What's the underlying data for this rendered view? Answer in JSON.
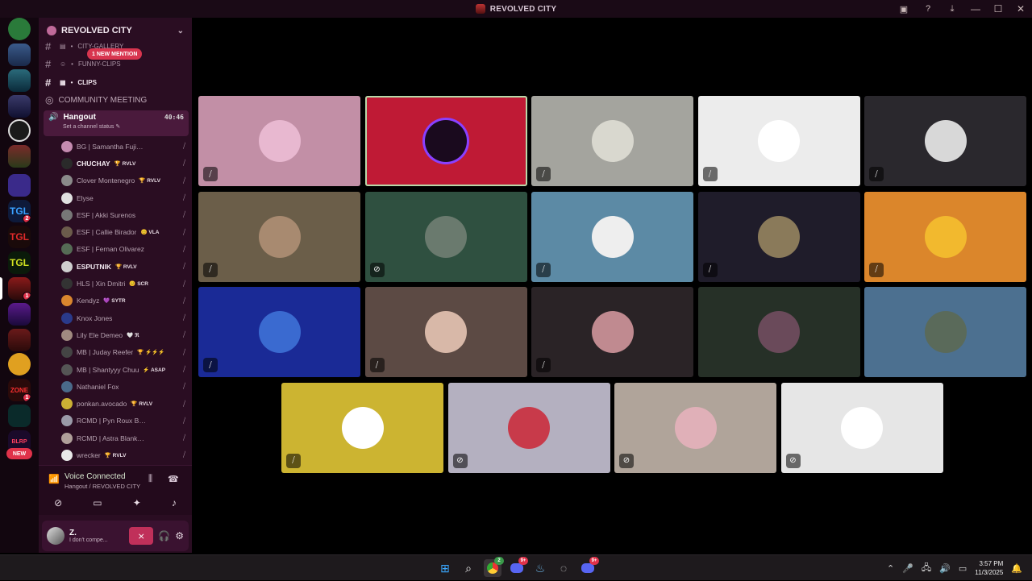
{
  "window": {
    "title": "REVOLVED CITY"
  },
  "titlebar_icons": [
    "inbox-icon",
    "help-icon",
    "download-icon"
  ],
  "server": {
    "name": "REVOLVED CITY",
    "new_badge": "NEW"
  },
  "server_badges": [
    "2",
    "1",
    "1",
    "1"
  ],
  "channels": [
    {
      "name": "CITY-GALLERY",
      "prefix": "•"
    },
    {
      "name": "FUNNY-CLIPS",
      "prefix": "•"
    },
    {
      "name": "CLIPS",
      "prefix": "•"
    }
  ],
  "mention_pill": "1 NEW MENTION",
  "voice_channels": {
    "community": "COMMUNITY MEETING",
    "hangout": {
      "name": "Hangout",
      "time": "40:46",
      "status": "Set a channel status"
    }
  },
  "members": [
    {
      "name": "BG | Samantha Fujiwara",
      "tag": "",
      "bold": false,
      "color": "#c58bb0"
    },
    {
      "name": "CHUCHAY",
      "tag": "🏆 RVLV",
      "bold": true,
      "color": "#2a2a2a"
    },
    {
      "name": "Clover Montenegro",
      "tag": "🏆 RVLV",
      "bold": false,
      "color": "#8a8a8a"
    },
    {
      "name": "Elyse",
      "tag": "",
      "bold": false,
      "color": "#e0e0e0"
    },
    {
      "name": "ESF | Akki Surenos",
      "tag": "",
      "bold": false,
      "color": "#777"
    },
    {
      "name": "ESF | Callie Birador",
      "tag": "😊 VLA",
      "bold": false,
      "color": "#6b5b4b"
    },
    {
      "name": "ESF | Fernan Olivarez",
      "tag": "",
      "bold": false,
      "color": "#556b55"
    },
    {
      "name": "ESPUTNIK",
      "tag": "🏆 RVLV",
      "bold": true,
      "color": "#cfcfcf"
    },
    {
      "name": "HLS | Xin Dmitri",
      "tag": "😊 SCR",
      "bold": false,
      "color": "#333"
    },
    {
      "name": "Kendyz",
      "tag": "💜 SYTR",
      "bold": false,
      "color": "#d9862e"
    },
    {
      "name": "Knox Jones",
      "tag": "",
      "bold": false,
      "color": "#2a3a8a"
    },
    {
      "name": "Lily Ele Demeo",
      "tag": "🤍 ℜ",
      "bold": false,
      "color": "#a08a80"
    },
    {
      "name": "MB | Juday Reefer",
      "tag": "🏆 ⚡⚡⚡",
      "bold": false,
      "color": "#444"
    },
    {
      "name": "MB | Shantyyy Chuu",
      "tag": "⚡ ASAP",
      "bold": false,
      "color": "#555"
    },
    {
      "name": "Nathaniel Fox",
      "tag": "",
      "bold": false,
      "color": "#4a6a8a"
    },
    {
      "name": "ponkan.avocado",
      "tag": "🏆 RVLV",
      "bold": false,
      "color": "#cbb034"
    },
    {
      "name": "RCMD | Pyn Roux Black",
      "tag": "",
      "bold": false,
      "color": "#9a9aa8"
    },
    {
      "name": "RCMD | Astra Blanko R...",
      "tag": "",
      "bold": false,
      "color": "#b0a09a"
    },
    {
      "name": "wrecker",
      "tag": "🏆 RVLV",
      "bold": false,
      "color": "#e8e8e8"
    }
  ],
  "voice_connected": {
    "title": "Voice Connected",
    "sub": "Hangout / REVOLVED CITY"
  },
  "user": {
    "name": "Z.",
    "status": "I don't compe..."
  },
  "tiles": [
    {
      "bg": "#c28fa6",
      "av": "#e8b8d0",
      "mic": "muted",
      "speaking": false
    },
    {
      "bg": "#bf1a35",
      "av": "#1a0a1e",
      "mic": "none",
      "speaking": true
    },
    {
      "bg": "#a4a49e",
      "av": "#d9d8cf",
      "mic": "muted",
      "speaking": false
    },
    {
      "bg": "#ececec",
      "av": "#ffffff",
      "mic": "muted",
      "speaking": false
    },
    {
      "bg": "#2a282d",
      "av": "#d8d8d8",
      "mic": "muted",
      "speaking": false
    },
    {
      "bg": "#6b5e49",
      "av": "#a88a70",
      "mic": "muted",
      "speaking": false
    },
    {
      "bg": "#2f5040",
      "av": "#6a7a6e",
      "mic": "deaf",
      "speaking": false
    },
    {
      "bg": "#5c8aa5",
      "av": "#eeeeee",
      "mic": "muted",
      "speaking": false
    },
    {
      "bg": "#1f1c2a",
      "av": "#8a7a5a",
      "mic": "muted",
      "speaking": false
    },
    {
      "bg": "#db862b",
      "av": "#f2b92e",
      "mic": "muted",
      "speaking": false
    },
    {
      "bg": "#1a2a96",
      "av": "#3a6ad0",
      "mic": "muted",
      "speaking": false
    },
    {
      "bg": "#5c4a44",
      "av": "#d8b8a8",
      "mic": "muted",
      "speaking": false
    },
    {
      "bg": "#2a2326",
      "av": "#c08a90",
      "mic": "muted",
      "speaking": false
    },
    {
      "bg": "#263027",
      "av": "#6a4a5a",
      "mic": "none",
      "speaking": false
    },
    {
      "bg": "#4c7090",
      "av": "#5a6a5a",
      "mic": "none",
      "speaking": false
    },
    {
      "bg": "#ccb431",
      "av": "#ffffff",
      "mic": "muted",
      "speaking": false
    },
    {
      "bg": "#b4b0c0",
      "av": "#c83a4a",
      "mic": "deaf",
      "speaking": false
    },
    {
      "bg": "#b0a49a",
      "av": "#e0b0b8",
      "mic": "deaf",
      "speaking": false
    },
    {
      "bg": "#e6e6e6",
      "av": "#ffffff",
      "mic": "deaf",
      "speaking": false
    }
  ],
  "taskbar": {
    "time": "3:57 PM",
    "date": "11/3/2025",
    "badges": {
      "chrome": "2",
      "discord1": "9+",
      "discord2": "9+"
    }
  }
}
